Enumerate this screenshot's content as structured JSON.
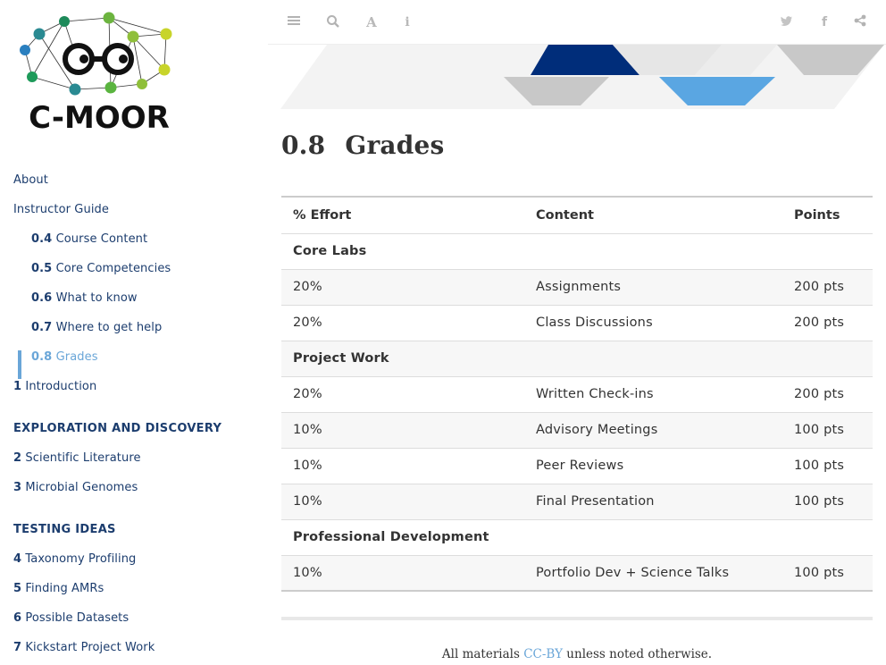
{
  "logo": {
    "text": "C-MOOR"
  },
  "sidebar": {
    "items": [
      {
        "num": "",
        "label": "About",
        "level": "top",
        "active": false
      },
      {
        "num": "",
        "label": "Instructor Guide",
        "level": "top",
        "active": false
      },
      {
        "num": "0.4",
        "label": "Course Content",
        "level": "sub",
        "active": false
      },
      {
        "num": "0.5",
        "label": "Core Competencies",
        "level": "sub",
        "active": false
      },
      {
        "num": "0.6",
        "label": "What to know",
        "level": "sub",
        "active": false
      },
      {
        "num": "0.7",
        "label": "Where to get help",
        "level": "sub",
        "active": false
      },
      {
        "num": "0.8",
        "label": "Grades",
        "level": "sub",
        "active": true
      },
      {
        "num": "1",
        "label": "Introduction",
        "level": "top",
        "active": false
      }
    ],
    "section1": {
      "title": "EXPLORATION AND DISCOVERY",
      "items": [
        {
          "num": "2",
          "label": "Scientific Literature"
        },
        {
          "num": "3",
          "label": "Microbial Genomes"
        }
      ]
    },
    "section2": {
      "title": "TESTING IDEAS",
      "items": [
        {
          "num": "4",
          "label": "Taxonomy Profiling"
        },
        {
          "num": "5",
          "label": "Finding AMRs"
        },
        {
          "num": "6",
          "label": "Possible Datasets"
        },
        {
          "num": "7",
          "label": "Kickstart Project Work"
        }
      ]
    }
  },
  "toolbar": {
    "left_icons": [
      "menu-icon",
      "search-icon",
      "font-icon",
      "info-icon"
    ],
    "right_icons": [
      "twitter-icon",
      "facebook-icon",
      "share-icon"
    ]
  },
  "page": {
    "number": "0.8",
    "title": "Grades"
  },
  "table": {
    "headers": [
      "% Effort",
      "Content",
      "Points"
    ],
    "rows": [
      {
        "type": "group",
        "cells": [
          "Core Labs",
          "",
          ""
        ]
      },
      {
        "type": "row",
        "cells": [
          "20%",
          "Assignments",
          "200 pts"
        ]
      },
      {
        "type": "row",
        "cells": [
          "20%",
          "Class Discussions",
          "200 pts"
        ]
      },
      {
        "type": "group",
        "cells": [
          "Project Work",
          "",
          ""
        ]
      },
      {
        "type": "row",
        "cells": [
          "20%",
          "Written Check-ins",
          "200 pts"
        ]
      },
      {
        "type": "row",
        "cells": [
          "10%",
          "Advisory Meetings",
          "100 pts"
        ]
      },
      {
        "type": "row",
        "cells": [
          "10%",
          "Peer Reviews",
          "100 pts"
        ]
      },
      {
        "type": "row",
        "cells": [
          "10%",
          "Final Presentation",
          "100 pts"
        ]
      },
      {
        "type": "group",
        "cells": [
          "Professional Development",
          "",
          ""
        ]
      },
      {
        "type": "row",
        "cells": [
          "10%",
          "Portfolio Dev + Science Talks",
          "100 pts"
        ]
      }
    ]
  },
  "footer": {
    "prefix": "All materials ",
    "link": "CC-BY",
    "suffix": " unless noted otherwise."
  },
  "colors": {
    "nav_text": "#1c3d6e",
    "active": "#6aa6d8",
    "banner_dark": "#002d7a",
    "banner_light": "#5aa6e2",
    "banner_grey": "#c8c8c8"
  }
}
